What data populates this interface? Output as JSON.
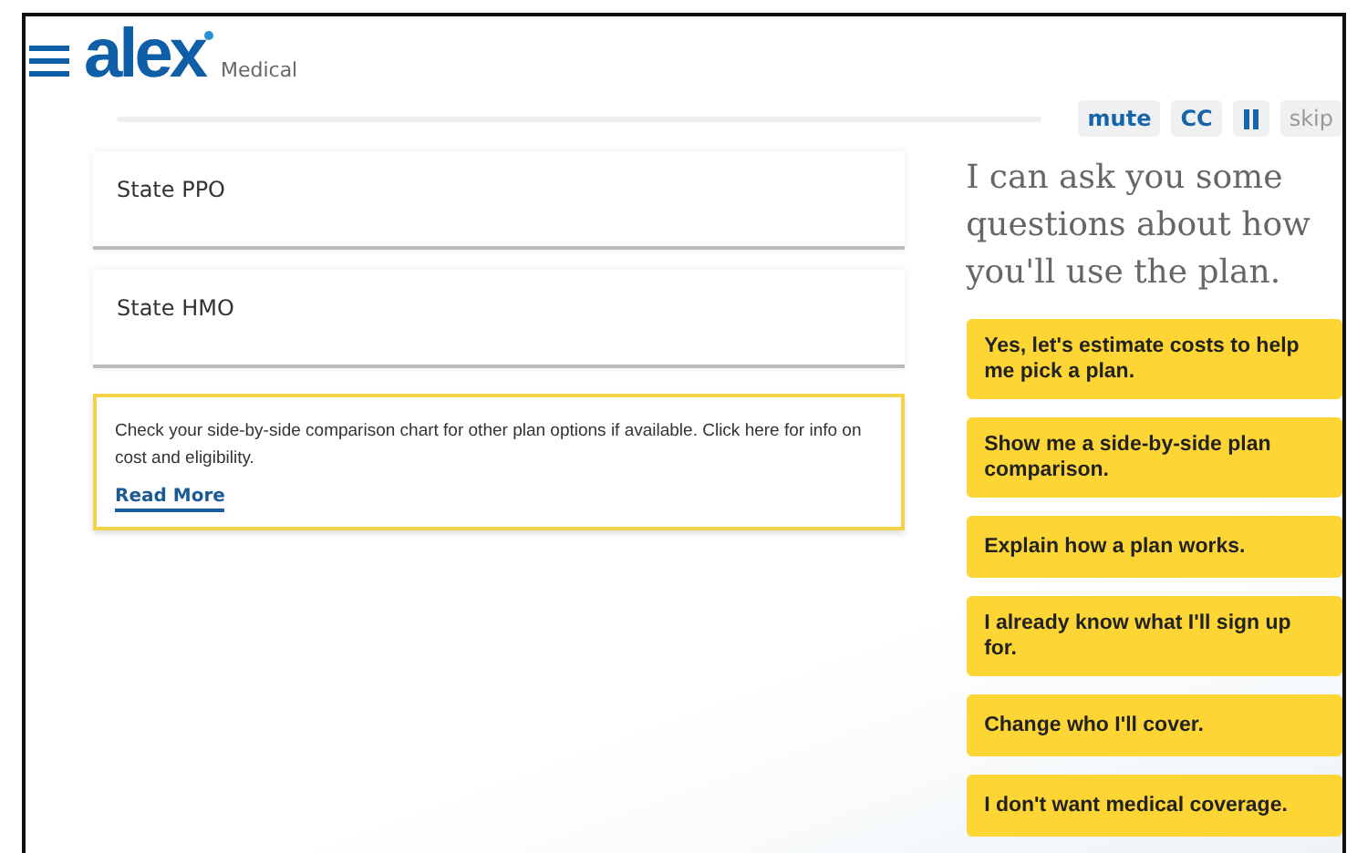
{
  "header": {
    "logo": "alex",
    "product": "Medical"
  },
  "controls": [
    {
      "kind": "text",
      "label": "mute",
      "disabled": false
    },
    {
      "kind": "text",
      "label": "CC",
      "disabled": false
    },
    {
      "kind": "pause",
      "disabled": false
    },
    {
      "kind": "text",
      "label": "skip",
      "disabled": true
    }
  ],
  "plans": [
    {
      "name": "State PPO"
    },
    {
      "name": "State HMO"
    }
  ],
  "notice": {
    "text": "Check your side-by-side comparison chart for other plan options if available. Click here for info on cost and eligibility.",
    "link": "Read More"
  },
  "prompt": "I can ask you some questions about how you'll use the plan.",
  "choices": [
    "Yes, let's estimate costs to help me pick a plan.",
    "Show me a side-by-side plan comparison.",
    "Explain how a plan works.",
    "I already know what I'll sign up for.",
    "Change who I'll cover.",
    "I don't want medical coverage."
  ]
}
